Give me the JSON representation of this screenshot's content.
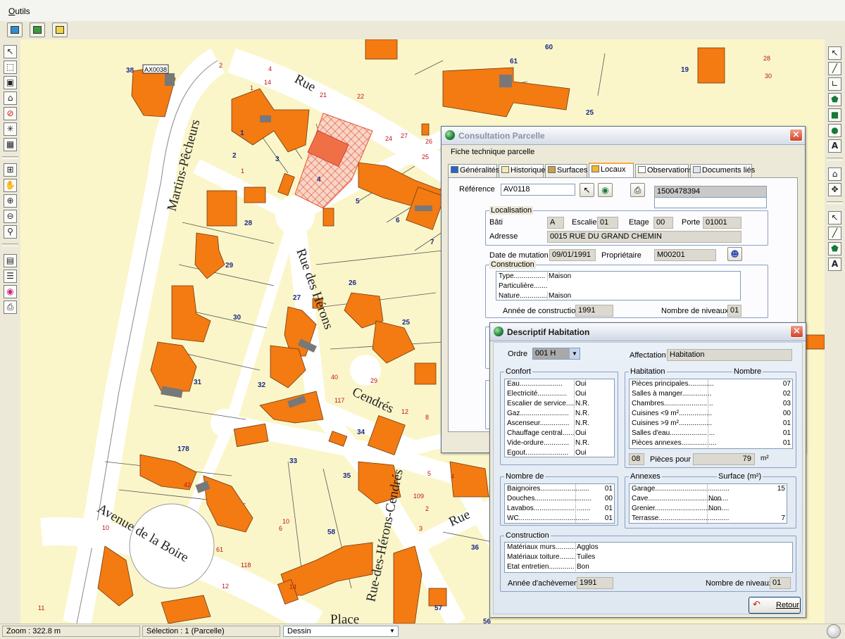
{
  "menubar": {
    "items": [
      {
        "label": "Outils"
      }
    ]
  },
  "statusbar": {
    "zoom": "Zoom : 322.8 m",
    "selection": "Sélection : 1 (Parcelle)",
    "layer": "Dessin"
  },
  "map": {
    "parcel_labels": [
      "38",
      "19",
      "61",
      "60",
      "25",
      "1",
      "2",
      "3",
      "4",
      "5",
      "6",
      "7",
      "28",
      "29",
      "26",
      "27",
      "30",
      "25",
      "31",
      "32",
      "34",
      "178",
      "33",
      "35",
      "58",
      "36",
      "57",
      "56"
    ],
    "selected_parcel_tag": "AX0038",
    "street_names": [
      "Rue",
      "Martins-Pêcheurs",
      "Rue des Hérons",
      "Cendrés",
      "Avenue de la Boire",
      "Rue-des-Hérons-Cendrés",
      "Rue",
      "Place"
    ],
    "street_numbers": [
      "2",
      "4",
      "1",
      "14",
      "22",
      "21",
      "24",
      "25",
      "26",
      "27",
      "28",
      "29",
      "30",
      "12",
      "8",
      "40",
      "42",
      "10",
      "118",
      "61",
      "12",
      "14",
      "11",
      "10",
      "117",
      "109",
      "2",
      "3",
      "4",
      "5",
      "6",
      "1"
    ]
  },
  "consultation": {
    "title": "Consultation Parcelle",
    "subtitle": "Fiche technique parcelle",
    "tabs": [
      "Généralités",
      "Historique",
      "Surfaces",
      "Locaux",
      "Observations",
      "Documents liés"
    ],
    "active_tab": "Locaux",
    "reference_label": "Référence",
    "reference_value": "AV0118",
    "invariant": "1500478394",
    "localisation": {
      "group": "Localisation",
      "bati_label": "Bâti",
      "bati": "A",
      "escalier_label": "Escalier",
      "escalier": "01",
      "etage_label": "Etage",
      "etage": "00",
      "porte_label": "Porte",
      "porte": "01001",
      "adresse_label": "Adresse",
      "adresse": "0015 RUE DU GRAND CHEMIN"
    },
    "mutation_label": "Date de mutation",
    "mutation": "09/01/1991",
    "proprietaire_label": "Propriétaire",
    "proprietaire": "M00201",
    "construction": {
      "group": "Construction",
      "rows": [
        {
          "k": "Type................",
          "v": "Maison"
        },
        {
          "k": "Particulière.......",
          "v": ""
        },
        {
          "k": "Nature..............",
          "v": "Maison"
        }
      ],
      "annee_label": "Année de construction",
      "annee": "1991",
      "niveaux_label": "Nombre de niveaux",
      "niveaux": "01"
    }
  },
  "descriptif": {
    "title": "Descriptif Habitation",
    "ordre_label": "Ordre",
    "ordre": "001 H",
    "affectation_label": "Affectation",
    "affectation": "Habitation",
    "confort": {
      "group": "Confort",
      "rows": [
        {
          "k": "Eau......................",
          "v": "Oui"
        },
        {
          "k": "Electricité...............",
          "v": "Oui"
        },
        {
          "k": "Escalier de service....",
          "v": "N.R."
        },
        {
          "k": "Gaz.........................",
          "v": "N.R."
        },
        {
          "k": "Ascenseur...............",
          "v": "N.R."
        },
        {
          "k": "Chauffage central......",
          "v": "Oui"
        },
        {
          "k": "Vide-ordure.............",
          "v": "N.R."
        },
        {
          "k": "Egout......................",
          "v": "Oui"
        }
      ]
    },
    "habitation": {
      "group": "Habitation",
      "col2": "Nombre",
      "rows": [
        {
          "k": "Pièces principales.............",
          "v": "07"
        },
        {
          "k": "Salles à manger...............",
          "v": "02"
        },
        {
          "k": "Chambres.........................",
          "v": "03"
        },
        {
          "k": "Cuisines <9 m².................",
          "v": "00"
        },
        {
          "k": "Cuisines >9 m².................",
          "v": "01"
        },
        {
          "k": "Salles d'eau.......................",
          "v": "01"
        },
        {
          "k": "Pièces annexes..................",
          "v": "01"
        }
      ],
      "pieces_count": "08",
      "pieces_label": "Pièces pour",
      "pieces_surface": "79",
      "unit": "m²"
    },
    "nombre_de": {
      "group": "Nombre de",
      "rows": [
        {
          "k": "Baignoires.........................",
          "v": "01"
        },
        {
          "k": "Douches.............................",
          "v": "00"
        },
        {
          "k": "Lavabos.............................",
          "v": "01"
        },
        {
          "k": "WC....................................",
          "v": "01"
        }
      ]
    },
    "annexes": {
      "group": "Annexes",
      "col2": "Surface (m²)",
      "rows": [
        {
          "k": "Garage......................................",
          "v": "15"
        },
        {
          "k": "Cave.........................................",
          "v": "Non"
        },
        {
          "k": "Grenier......................................",
          "v": "Non"
        },
        {
          "k": "Terrasse....................................",
          "v": "7"
        }
      ]
    },
    "construction": {
      "group": "Construction",
      "rows": [
        {
          "k": "Matériaux murs..........",
          "v": "Agglos"
        },
        {
          "k": "Matériaux toiture........",
          "v": "Tuiles"
        },
        {
          "k": "Etat entretien.............",
          "v": "Bon"
        }
      ],
      "achevement_label": "Année d'achèvement",
      "achevement": "1991",
      "niveaux_label": "Nombre de niveaux",
      "niveaux": "01"
    },
    "retour_label": "Retour"
  },
  "colors": {
    "building": "#f47a12",
    "parcel_bg": "#fbf6c9",
    "road": "#ffffff",
    "selected": "#e8503a"
  }
}
